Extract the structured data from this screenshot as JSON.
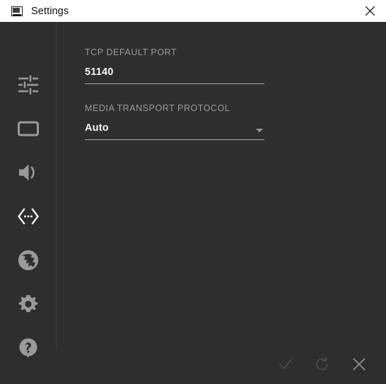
{
  "window": {
    "title": "Settings",
    "app_icon": "monitor-icon",
    "close_icon": "close-icon",
    "background_color": "#2e2e2e",
    "titlebar_color": "#ffffff"
  },
  "sidebar": {
    "items": [
      {
        "icon": "sliders-icon",
        "name": "sidebar-item-general",
        "active": false
      },
      {
        "icon": "monitor-icon",
        "name": "sidebar-item-display",
        "active": false
      },
      {
        "icon": "speaker-icon",
        "name": "sidebar-item-audio",
        "active": false
      },
      {
        "icon": "code-brackets-icon",
        "name": "sidebar-item-network",
        "active": true
      },
      {
        "icon": "globe-icon",
        "name": "sidebar-item-language",
        "active": false
      },
      {
        "icon": "gear-icon",
        "name": "sidebar-item-advanced",
        "active": false
      },
      {
        "icon": "help-icon",
        "name": "sidebar-item-help",
        "active": false
      }
    ],
    "icon_color": "#9a9a9a",
    "active_icon_color": "#f2f2f2"
  },
  "main": {
    "fields": [
      {
        "label": "TCP DEFAULT PORT",
        "value": "51140",
        "type": "text"
      },
      {
        "label": "MEDIA TRANSPORT PROTOCOL",
        "value": "Auto",
        "type": "select"
      }
    ]
  },
  "footer": {
    "buttons": [
      {
        "icon": "check-icon",
        "name": "apply-button",
        "enabled": false
      },
      {
        "icon": "refresh-icon",
        "name": "reset-button",
        "enabled": false
      },
      {
        "icon": "close-icon",
        "name": "close-button",
        "enabled": true
      }
    ]
  }
}
